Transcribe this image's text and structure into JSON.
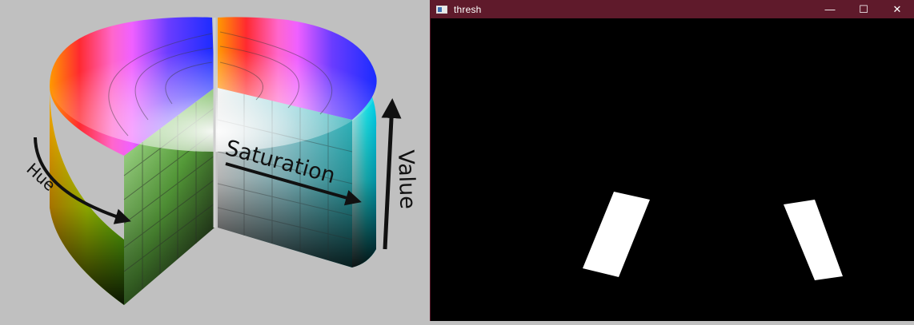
{
  "figure": {
    "labels": {
      "hue": "Hue",
      "saturation": "Saturation",
      "value": "Value"
    }
  },
  "window": {
    "title": "thresh",
    "controls": {
      "minimize": "—",
      "maximize": "☐",
      "close": "✕"
    }
  },
  "colors": {
    "titlebar": "#5f1a2b",
    "canvas": "#000000",
    "blob": "#ffffff",
    "figure_bg": "#c0c0c0"
  },
  "icons": {
    "app": "window-app-icon",
    "minimize": "minimize-icon",
    "maximize": "maximize-icon",
    "close": "close-icon"
  }
}
